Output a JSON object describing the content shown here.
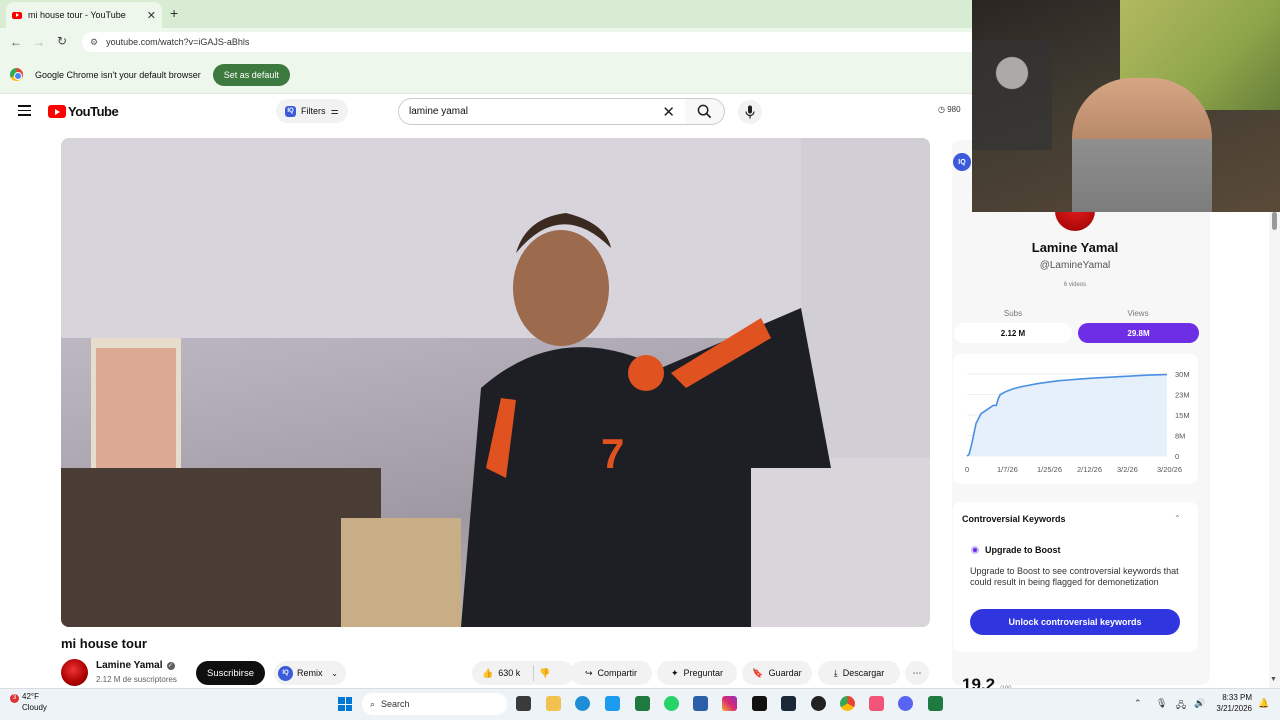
{
  "browser": {
    "tab_title": "mi house tour - YouTube",
    "url": "youtube.com/watch?v=iGAJS-aBhls",
    "infobar_text": "Google Chrome isn't your default browser",
    "set_default_label": "Set as default"
  },
  "youtube": {
    "logo_text": "YouTube",
    "filters_label": "Filters",
    "search_query": "lamine yamal",
    "header_count": "980"
  },
  "video": {
    "title": "mi house tour",
    "channel_name": "Lamine Yamal",
    "subscriber_text": "2.12 M de suscriptores",
    "subscribe_label": "Suscribirse",
    "remix_label": "Remix",
    "likes": "630 k",
    "share_label": "Compartir",
    "ask_label": "Preguntar",
    "save_label": "Guardar",
    "download_label": "Descargar"
  },
  "panel": {
    "name": "Lamine Yamal",
    "handle": "@LamineYamal",
    "videos": "6 videos",
    "subs_label": "Subs",
    "views_label": "Views",
    "subs_value": "2.12 M",
    "views_value": "29.8M",
    "keywords_title": "Controversial Keywords",
    "upgrade_title": "Upgrade to Boost",
    "upgrade_text": "Upgrade to Boost to see controversial keywords that could result in being flagged for demonetization",
    "unlock_label": "Unlock controversial keywords",
    "score": "19.2",
    "score_suffix": "/100"
  },
  "chart_data": {
    "type": "area",
    "x_ticks": [
      "0",
      "1/7/26",
      "1/25/26",
      "2/12/26",
      "3/2/26",
      "3/20/26"
    ],
    "y_ticks": [
      "30M",
      "23M",
      "15M",
      "8M",
      "0"
    ],
    "ylim": [
      0,
      30
    ],
    "x": [
      0,
      2,
      5,
      9,
      14,
      18,
      22,
      26,
      29,
      31,
      33,
      38,
      45,
      52,
      60,
      70,
      80,
      90,
      100,
      110,
      120,
      130,
      140,
      150,
      160,
      170,
      180,
      190,
      198
    ],
    "y": [
      0,
      0.5,
      5,
      12,
      15.5,
      16.5,
      17.5,
      18.5,
      18.5,
      21,
      22.5,
      23.5,
      24.5,
      25.2,
      25.8,
      26.5,
      27,
      27.5,
      27.8,
      28.1,
      28.4,
      28.6,
      28.8,
      29.0,
      29.2,
      29.4,
      29.6,
      29.7,
      29.8
    ],
    "color": "#4a90e2"
  },
  "taskbar": {
    "temp": "42°F",
    "condition": "Cloudy",
    "notif_count": "3",
    "search_label": "Search",
    "time": "8:33 PM",
    "date": "3/21/2026"
  }
}
